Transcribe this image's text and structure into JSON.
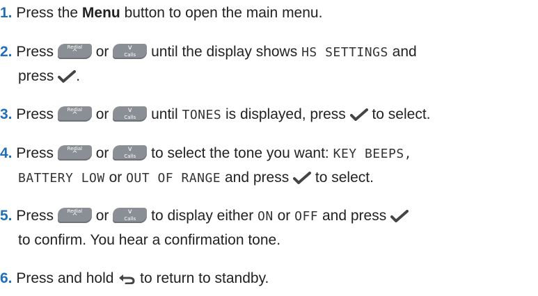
{
  "steps": [
    {
      "num": "1.",
      "t1": "Press the ",
      "bold": "Menu",
      "t2": " button to open the main menu."
    },
    {
      "num": "2.",
      "press": "Press",
      "or": "or",
      "t1": "until the display shows",
      "lcd": "HS SETTINGS",
      "t2": "and",
      "t3": "press",
      "t4": "."
    },
    {
      "num": "3.",
      "press": "Press",
      "or": "or",
      "t1": "until",
      "lcd": "TONES",
      "t2": "is displayed, press",
      "t3": "to select."
    },
    {
      "num": "4.",
      "press": "Press",
      "or": "or",
      "t1": "to select the tone you want:",
      "lcd1": "KEY BEEPS,",
      "lcd2": "BATTERY LOW",
      "t2": "or",
      "lcd3": "OUT OF RANGE",
      "t3": "and press",
      "t4": "to select."
    },
    {
      "num": "5.",
      "press": "Press",
      "or": "or",
      "t1": "to display either",
      "lcd1": "ON",
      "t2": "or",
      "lcd2": "OFF",
      "t3": "and press",
      "t4": "to confirm. You hear a confirmation tone."
    },
    {
      "num": "6.",
      "t1": "Press and hold",
      "t2": "to return to standby."
    }
  ],
  "keys": {
    "redial_label": "Redial",
    "redial_glyph": "^",
    "calls_label": "Calls",
    "calls_glyph": "v"
  },
  "colors": {
    "step_number": "#1f6fb8",
    "key_fill": "#8a8f95"
  }
}
